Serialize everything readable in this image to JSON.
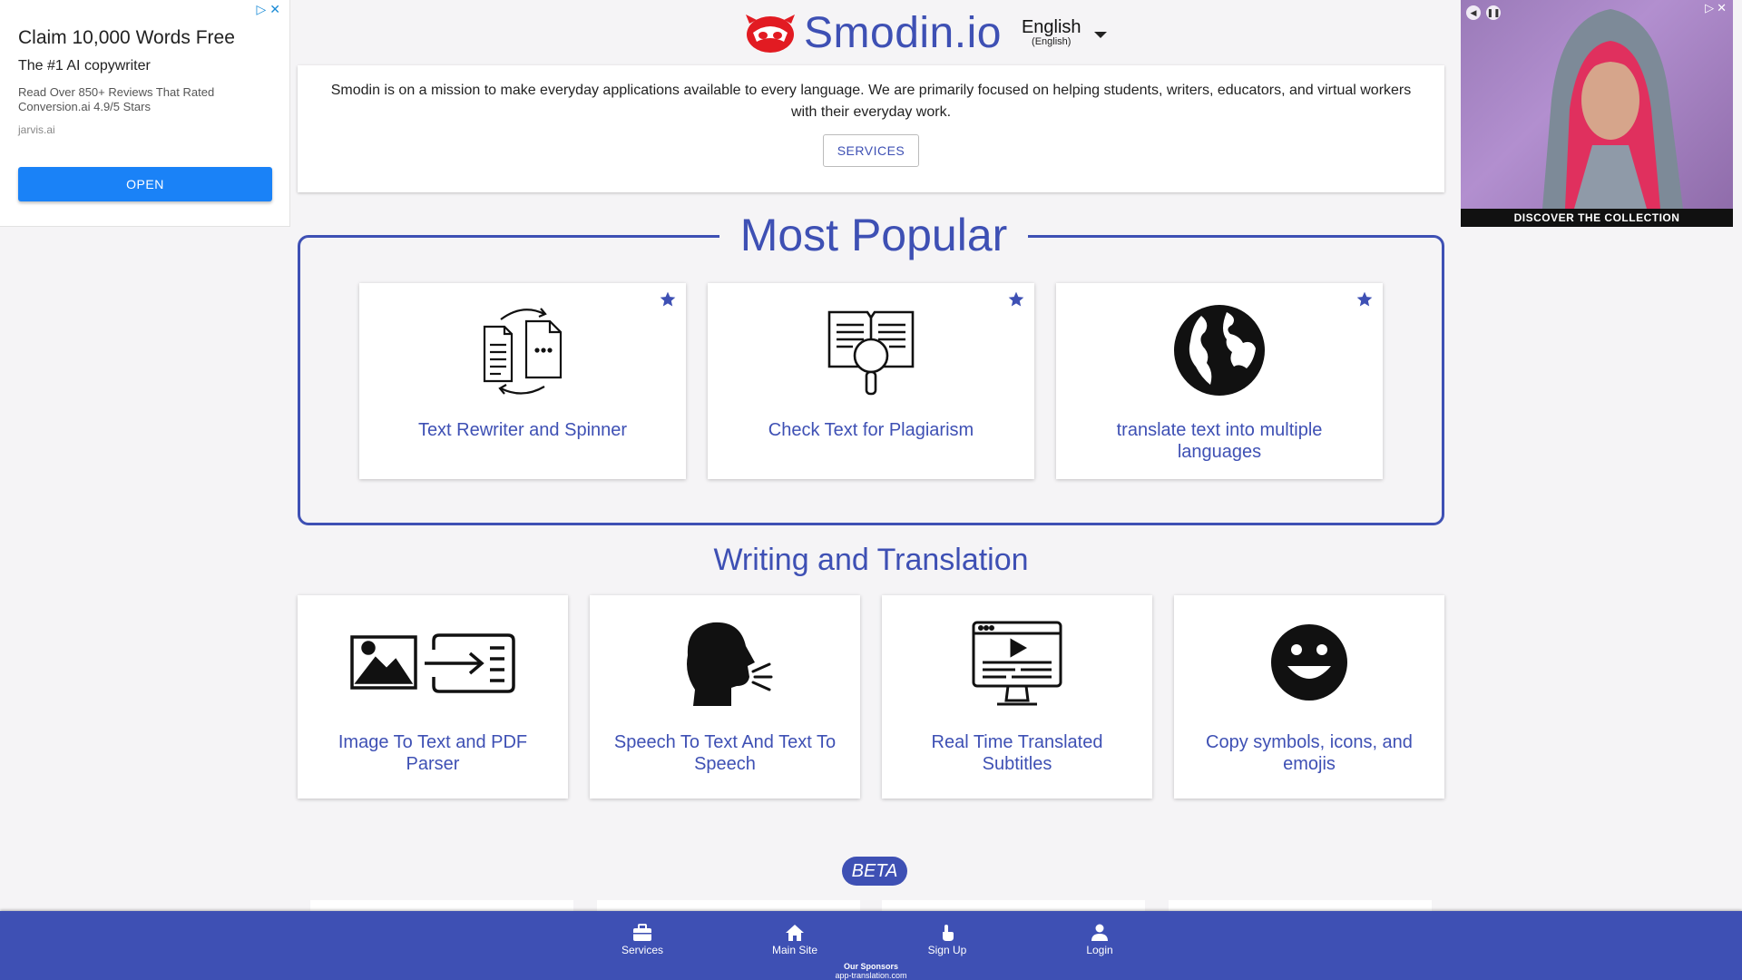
{
  "ad_left": {
    "title": "Claim 10,000 Words Free",
    "subtitle": "The #1 AI copywriter",
    "body": "Read Over 850+ Reviews That Rated Conversion.ai 4.9/5 Stars",
    "domain": "jarvis.ai",
    "button": "OPEN"
  },
  "ad_right": {
    "caption": "DISCOVER THE COLLECTION"
  },
  "header": {
    "logo_text": "Smodin.io",
    "language": "English",
    "language_native": "(English)"
  },
  "mission": {
    "text": "Smodin is on a mission to make everyday applications available to every language. We are primarily focused on helping students, writers, educators, and virtual workers with their everyday work.",
    "button": "SERVICES"
  },
  "popular": {
    "title": "Most Popular",
    "cards": [
      {
        "label": "Text Rewriter and Spinner",
        "icon": "documents-rewrite-icon",
        "starred": true
      },
      {
        "label": "Check Text for Plagiarism",
        "icon": "book-magnifier-icon",
        "starred": true
      },
      {
        "label": "translate text into multiple languages",
        "icon": "globe-icon",
        "starred": true
      }
    ]
  },
  "writing": {
    "title": "Writing and Translation",
    "cards": [
      {
        "label": "Image To Text and PDF Parser",
        "icon": "image-to-text-icon"
      },
      {
        "label": "Speech To Text And Text To Speech",
        "icon": "speaking-head-icon"
      },
      {
        "label": "Real Time Translated Subtitles",
        "icon": "monitor-video-icon"
      },
      {
        "label": "Copy symbols, icons, and emojis",
        "icon": "smiley-icon"
      }
    ]
  },
  "beta_label": "BETA",
  "bottom_nav": {
    "items": [
      {
        "label": "Services",
        "icon": "briefcase-icon"
      },
      {
        "label": "Main Site",
        "icon": "home-icon"
      },
      {
        "label": "Sign Up",
        "icon": "hand-pointer-icon"
      },
      {
        "label": "Login",
        "icon": "person-icon"
      }
    ],
    "sponsors_heading": "Our Sponsors",
    "sponsors_site": "app-translation.com"
  },
  "colors": {
    "brand": "#3e50b4",
    "background": "#f5f4f6",
    "ad_button": "#1a82f7"
  }
}
